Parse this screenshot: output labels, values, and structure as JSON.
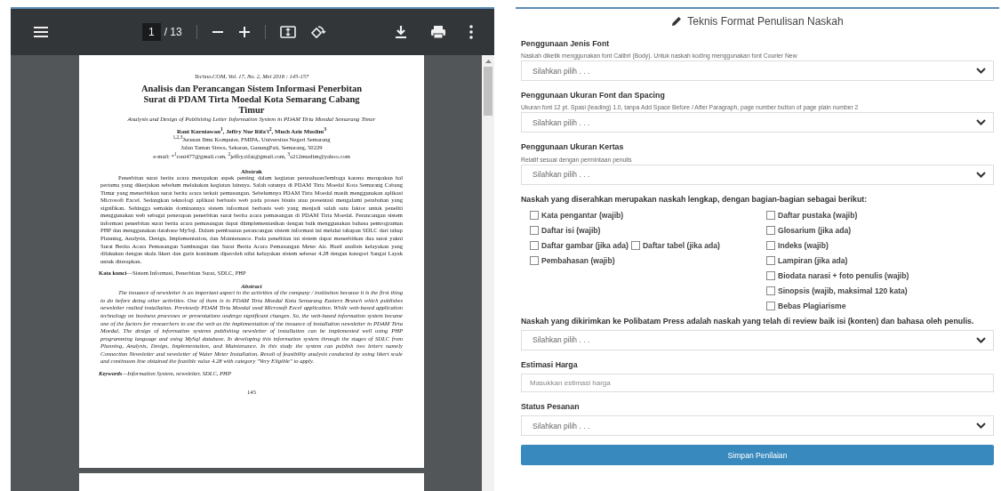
{
  "viewer": {
    "page_input": "1",
    "page_total": "/ 13",
    "document": {
      "journal": "Techno.COM, Vol. 17, No. 2, Mei 2018 : 145-157",
      "title": "Analisis dan Perancangan Sistem Informasi Penerbitan Surat di PDAM Tirta Moedal Kota Semarang Cabang Timur",
      "subtitle": "Analysis and Design of Publishing Letter Information System in PDAM Tirta Moedal Semarang Timur",
      "authors": "Roni Kurniawan$^{1}$, Jeffry Nur Rifa'i$^{2}$, Much Aziz Muslim$^{3}$",
      "affiliation": [
        "$^{1,2,3}$Jurusan Ilmu Komputer, FMIPA, Universitas Negeri Semarang",
        "Jalan Taman Siswa, Sekaran, GunungPati, Semarang, 50229",
        "e-mail: *$^{1}$roni477@gmail.com, $^{2}$jeffry.rifai@gmail.com, $^{3}$a212muslim@yahoo.com"
      ],
      "abstrak_heading": "Abstrak",
      "abstrak": "Penerbitan surat berita acara merupakan aspek penting dalam kegiatan perusahaan/lembaga karena merupakan hal pertama yang dikerjakan sebelum melakukan kegiatan lainnya. Salah satunya di PDAM Tirta Moedal Kota Semarang Cabang Timur yang menerbitkan surat berita acara terkait pemasangan. Sebelumnya PDAM Tirta Moedal masih menggunakan aplikasi Microsoft Excel. Sedangkan teknologi aplikasi berbasis web pada proses bisnis atau presentasi mengalami perubahan yang signifikan. Sehingga semakin dominannya sistem informasi berbasis web yang menjadi salah satu faktor untuk peneliti menggunakan web sebagai penerapan penerbitan surat berita acara pemasangan di PDAM Tirta Moedal. Perancangan sistem informasi penerbitan surat berita acara pemasangan dapat diimplementasikan dengan baik menggunakan bahasa pemrograman PHP dan menggunakan database MySql. Dalam pembuatan perancangan sistem informasi ini melalui tahapan SDLC dari tahap Planning, Analysis, Design, Implementation, dan Maintenance. Pada penelitian ini sistem dapat menerbitkan dua surat yakni Surat Berita Acara Pemasangan Sambungan dan Surat Berita Acara Pemasangan Meter Air. Hasil analisis kelayakan yang dilakukan dengan skala likert dan garis kontinum diperoleh nilai kelayakan sistem sebesar 4.28 dengan kategori Sangat Layak untuk diterapkan.",
      "kata_kunci": "**Kata kunci**—Sistem Informasi, Penerbitan Surat, SDLC, PHP",
      "abstract_heading": "Abstract",
      "abstract": "The issuance of newsletter is an important aspect in the activities of the company / institution because it is the first thing to do before doing other activities. One of them is in PDAM Tirta Moedal Kota Semarang Eastern Branch which publishes newsletter realted installation. Previously PDAM Tirta Moedal used Microsoft Excel application. While web-based application technology on business processes or presentations undergo significant changes. So, the web-based information system became one of the factors for researchers to use the web as the implementation of the issuance of installation newsletter in PDAM Tirta Moedal. The design of information systems publishing newsletter of installation can be implemented well using PHP programming language and using MySql database. In developing this information system through the stages of SDLC from Planning, Analysis, Design, Implementation, and Maintenance. In this study the system can publish two letters namely Connection Newsletter and newsletter of Water Meter Installation. Result of feasibility analysis conducted by using likert scale and continuum line obtained the feasible value 4.28 with category \"Very Eligible\" to apply.",
      "keywords": "**Keywords**—Information System, newsletter, SDLC, PHP",
      "page_number": "145"
    }
  },
  "form": {
    "title": "Teknis Format Penulisan Naskah",
    "fields_top": [
      {
        "kind": "select",
        "label": "Penggunaan Jenis Font",
        "hint": "Naskah diketik menggunakan font Calibri (Body). Untuk naskah koding menggunakan font Courier New",
        "placeholder": "Silahkan pilih . . ."
      },
      {
        "kind": "select",
        "label": "Penggunaan Ukuran Font dan Spacing",
        "hint": "Ukuran font 12 pt. Spasi (leading) 1.0, tanpa Add Space Before / After Paragraph, page number button of page plain number 2",
        "placeholder": "Silahkan pilih . . ."
      },
      {
        "kind": "select",
        "label": "Penggunaan Ukuran Kertas",
        "hint": "Relatif sesuai dengan permintaan penulis",
        "placeholder": "Silahkan pilih . . ."
      }
    ],
    "checklist": {
      "heading": "Naskah yang diserahkan merupakan naskah lengkap, dengan bagian-bagian sebagai berikut:",
      "columns": [
        [
          [
            {
              "label": "Kata pengantar (wajib)",
              "checked": false
            }
          ],
          [
            {
              "label": "Daftar isi (wajib)",
              "checked": false
            }
          ],
          [
            {
              "label": "Daftar gambar (jika ada)",
              "checked": false
            },
            {
              "label": "Daftar tabel (jika ada)",
              "checked": false
            }
          ],
          [
            {
              "label": "Pembahasan (wajib)",
              "checked": false
            }
          ]
        ],
        [
          [
            {
              "label": "Daftar pustaka (wajib)",
              "checked": false
            }
          ],
          [
            {
              "label": "Glosarium (jika ada)",
              "checked": false
            }
          ],
          [
            {
              "label": "Indeks (wajib)",
              "checked": false
            }
          ],
          [
            {
              "label": "Lampiran (jika ada)",
              "checked": false
            }
          ],
          [
            {
              "label": "Biodata narasi + foto penulis (wajib)",
              "checked": false
            }
          ],
          [
            {
              "label": "Sinopsis (wajib, maksimal 120 kata)",
              "checked": false
            }
          ],
          [
            {
              "label": "Bebas Plagiarisme",
              "checked": false
            }
          ]
        ]
      ]
    },
    "fields_bottom": [
      {
        "kind": "select",
        "label": "Naskah yang dikirimkan ke Polibatam Press adalah naskah yang telah di review baik isi (konten) dan bahasa oleh penulis.",
        "placeholder": "Silahkan pilih . . ."
      },
      {
        "kind": "text",
        "label": "Estimasi Harga",
        "placeholder": "Masukkan estimasi harga"
      },
      {
        "kind": "select",
        "label": "Status Pesanan",
        "placeholder": "Silahkan pilih . . ."
      }
    ],
    "submit": "Simpan Penilaian"
  }
}
